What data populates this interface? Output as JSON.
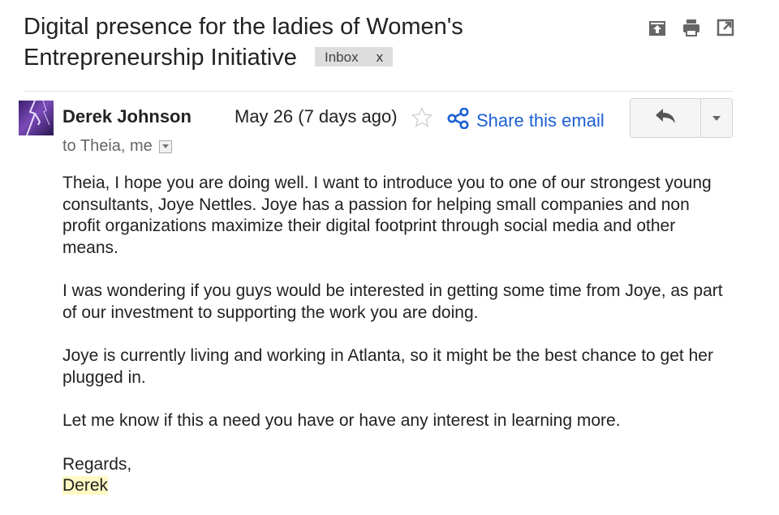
{
  "email": {
    "subject_line1": "Digital presence for the ladies of Women's",
    "subject_line2": "Entrepreneurship Initiative",
    "label": "Inbox",
    "label_remove": "x",
    "sender": "Derek Johnson",
    "date": "May 26 (7 days ago)",
    "share_label": "Share this email",
    "recipients": "to Theia, me",
    "body": [
      "Theia, I hope you are doing well.  I want to introduce you to one of our strongest young consultants, Joye Nettles.  Joye has a passion for helping small companies and non profit organizations maximize their digital footprint through social media and other means.",
      "I was wondering if you guys would be interested in getting some time from Joye, as part of our investment to supporting the work you are doing.",
      "Joye is currently living and working in Atlanta, so it might be the best chance to get her plugged in.",
      "Let me know if this a need you have or have any interest in learning more."
    ],
    "closing": "Regards,",
    "signature": "Derek"
  },
  "colors": {
    "link": "#1a5fd1",
    "label_bg": "#dddddd",
    "highlight": "#fff9c4"
  },
  "icons": [
    "expand-all-icon",
    "print-icon",
    "new-window-icon",
    "star-icon",
    "share-icon",
    "reply-icon",
    "chevron-down-icon",
    "avatar"
  ]
}
